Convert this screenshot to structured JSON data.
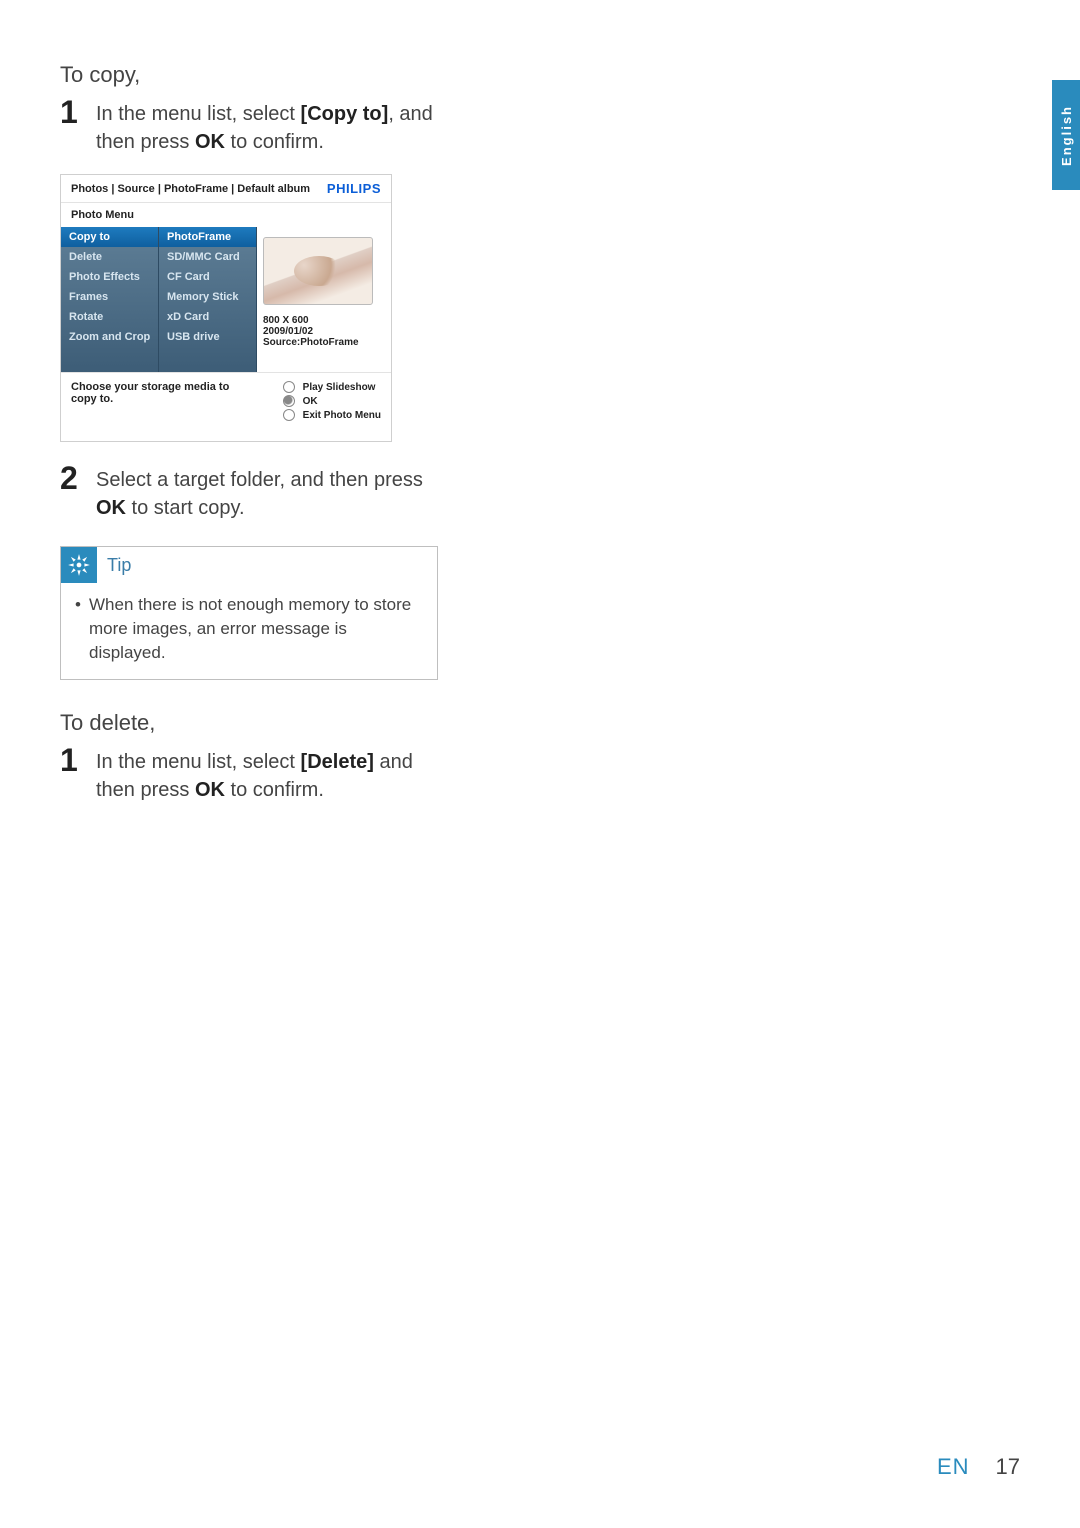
{
  "sections": {
    "copy_heading": "To copy,",
    "delete_heading": "To delete,"
  },
  "steps": {
    "copy1_num": "1",
    "copy1_a": "In the menu list, select ",
    "copy1_bold1": "[Copy to]",
    "copy1_b": ", and then press ",
    "copy1_bold2": "OK",
    "copy1_c": " to confirm.",
    "copy2_num": "2",
    "copy2_a": "Select a target folder, and then press ",
    "copy2_bold1": "OK",
    "copy2_b": " to start copy.",
    "del1_num": "1",
    "del1_a": "In the menu list, select ",
    "del1_bold1": "[Delete]",
    "del1_b": " and then press ",
    "del1_bold2": "OK",
    "del1_c": " to confirm."
  },
  "tip": {
    "title": "Tip",
    "bullet": "•",
    "text": "When there is not enough memory to store more images, an error message is displayed."
  },
  "device": {
    "breadcrumb": "Photos | Source | PhotoFrame | Default album",
    "brand": "PHILIPS",
    "menu_title": "Photo Menu",
    "col1": [
      "Copy to",
      "Delete",
      "Photo Effects",
      "Frames",
      "Rotate",
      "Zoom and Crop"
    ],
    "col1_selected_index": 0,
    "col2": [
      "PhotoFrame",
      "SD/MMC Card",
      "CF Card",
      "Memory Stick",
      "xD Card",
      "USB drive"
    ],
    "col2_selected_index": 0,
    "resolution": "800 X 600",
    "date": "2009/01/02",
    "source": "Source:PhotoFrame",
    "hint": "Choose your storage media to copy to.",
    "actions": [
      "Play Slideshow",
      "OK",
      "Exit Photo Menu"
    ],
    "actions_selected_index": 1
  },
  "side_tab": "English",
  "footer": {
    "lang": "EN",
    "page": "17"
  }
}
